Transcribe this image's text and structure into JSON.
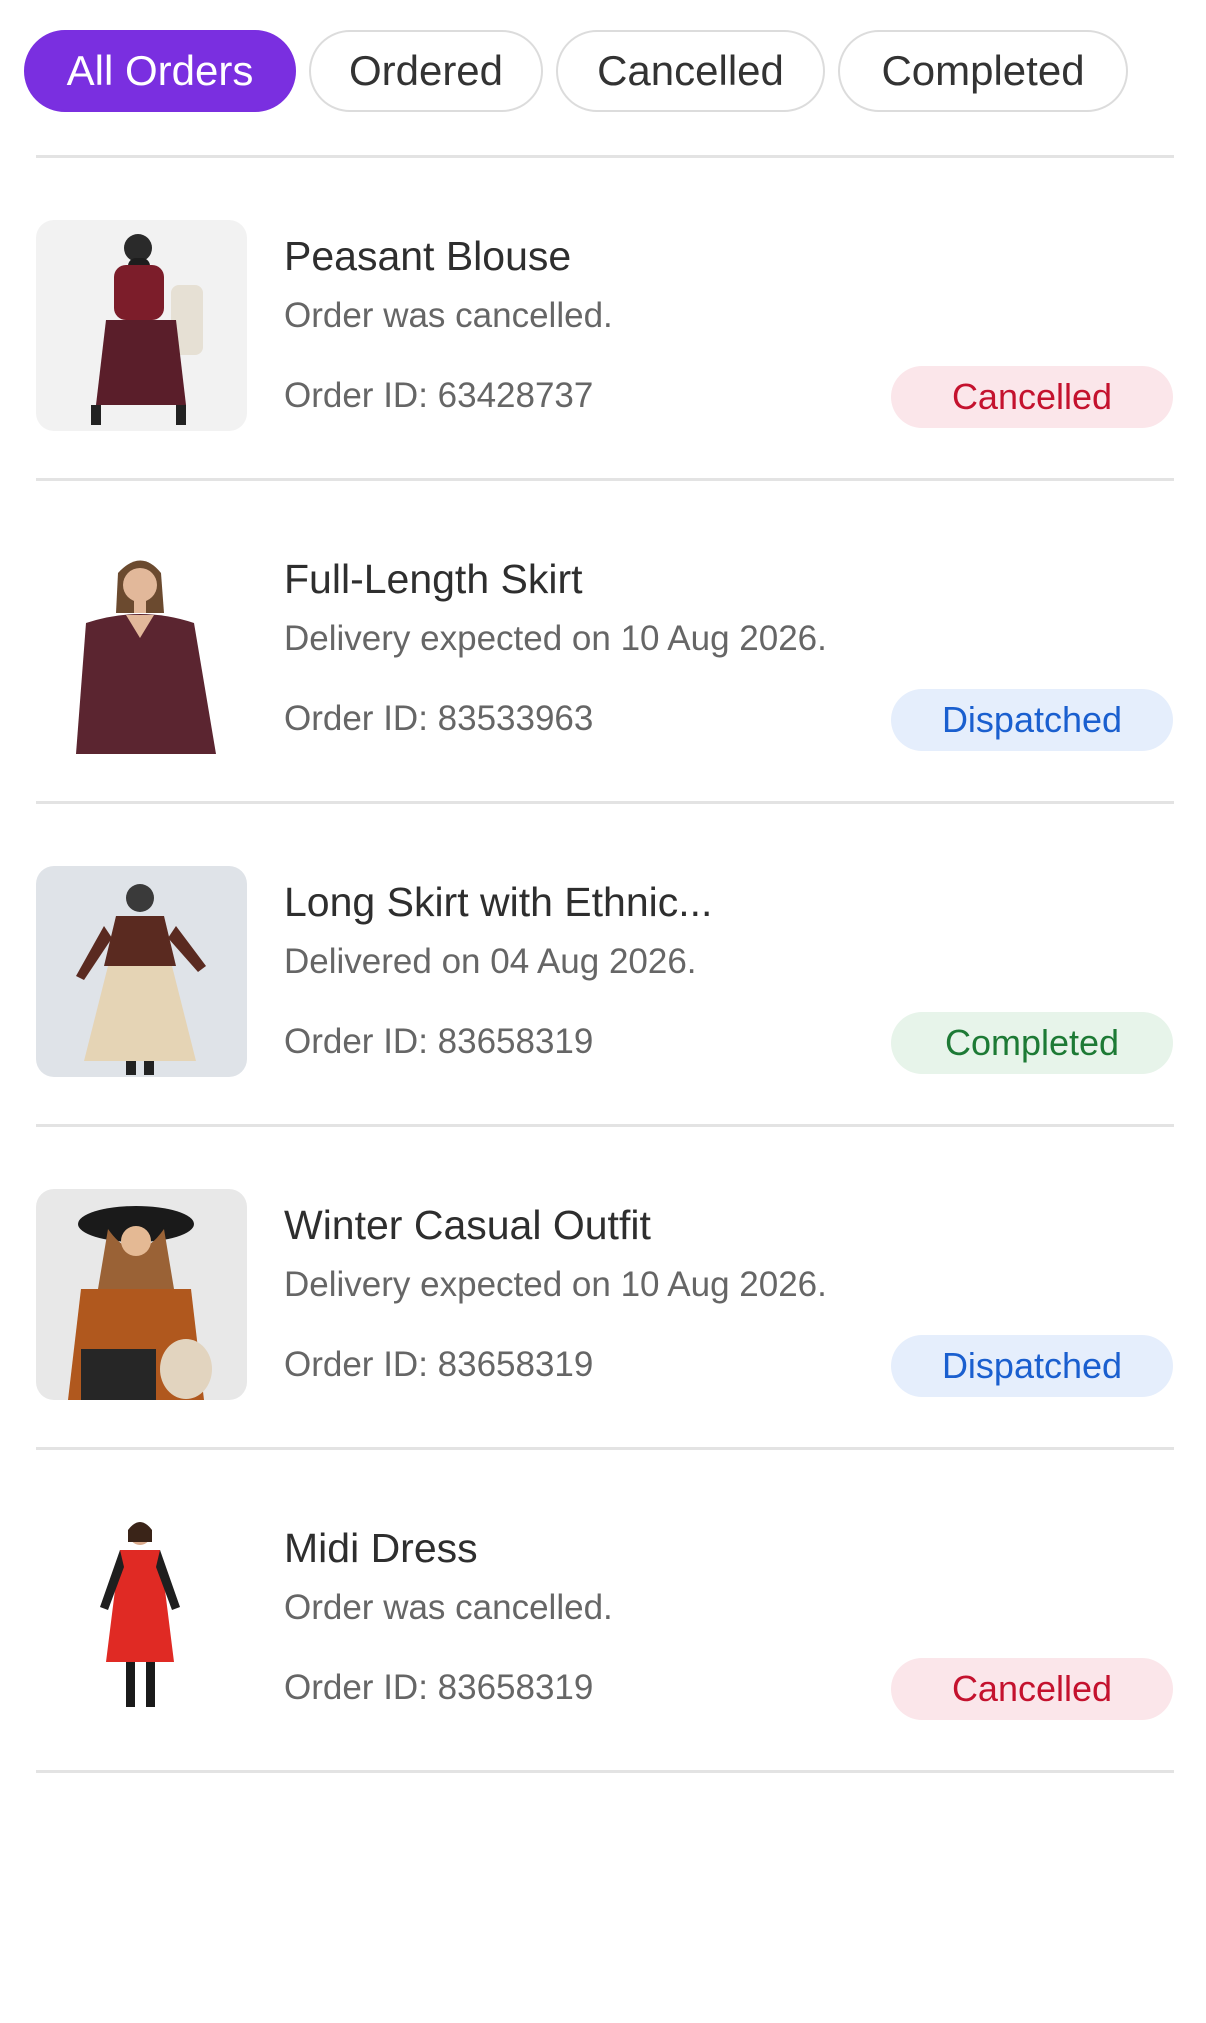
{
  "tabs": [
    {
      "label": "All Orders",
      "active": true
    },
    {
      "label": "Ordered",
      "active": false
    },
    {
      "label": "Cancelled",
      "active": false
    },
    {
      "label": "Completed",
      "active": false
    }
  ],
  "orders": [
    {
      "title": "Peasant Blouse",
      "status_text": "Order was cancelled.",
      "order_id": "Order ID: 63428737",
      "badge": "Cancelled",
      "badge_type": "cancelled"
    },
    {
      "title": "Full-Length Skirt",
      "status_text": "Delivery expected on 10 Aug 2026.",
      "order_id": "Order ID: 83533963",
      "badge": "Dispatched",
      "badge_type": "dispatched"
    },
    {
      "title": "Long Skirt with Ethnic...",
      "status_text": "Delivered on 04 Aug 2026.",
      "order_id": "Order ID: 83658319",
      "badge": "Completed",
      "badge_type": "completed"
    },
    {
      "title": "Winter Casual Outfit",
      "status_text": "Delivery expected on 10 Aug 2026.",
      "order_id": "Order ID: 83658319",
      "badge": "Dispatched",
      "badge_type": "dispatched"
    },
    {
      "title": "Midi Dress",
      "status_text": "Order was cancelled.",
      "order_id": "Order ID: 83658319",
      "badge": "Cancelled",
      "badge_type": "cancelled"
    }
  ],
  "colors": {
    "accent": "#7a2fe0",
    "cancelled_bg": "#fbe6ea",
    "cancelled_text": "#c4122e",
    "dispatched_bg": "#e5eefc",
    "dispatched_text": "#1a5fcf",
    "completed_bg": "#e7f4ea",
    "completed_text": "#1d7a35"
  }
}
